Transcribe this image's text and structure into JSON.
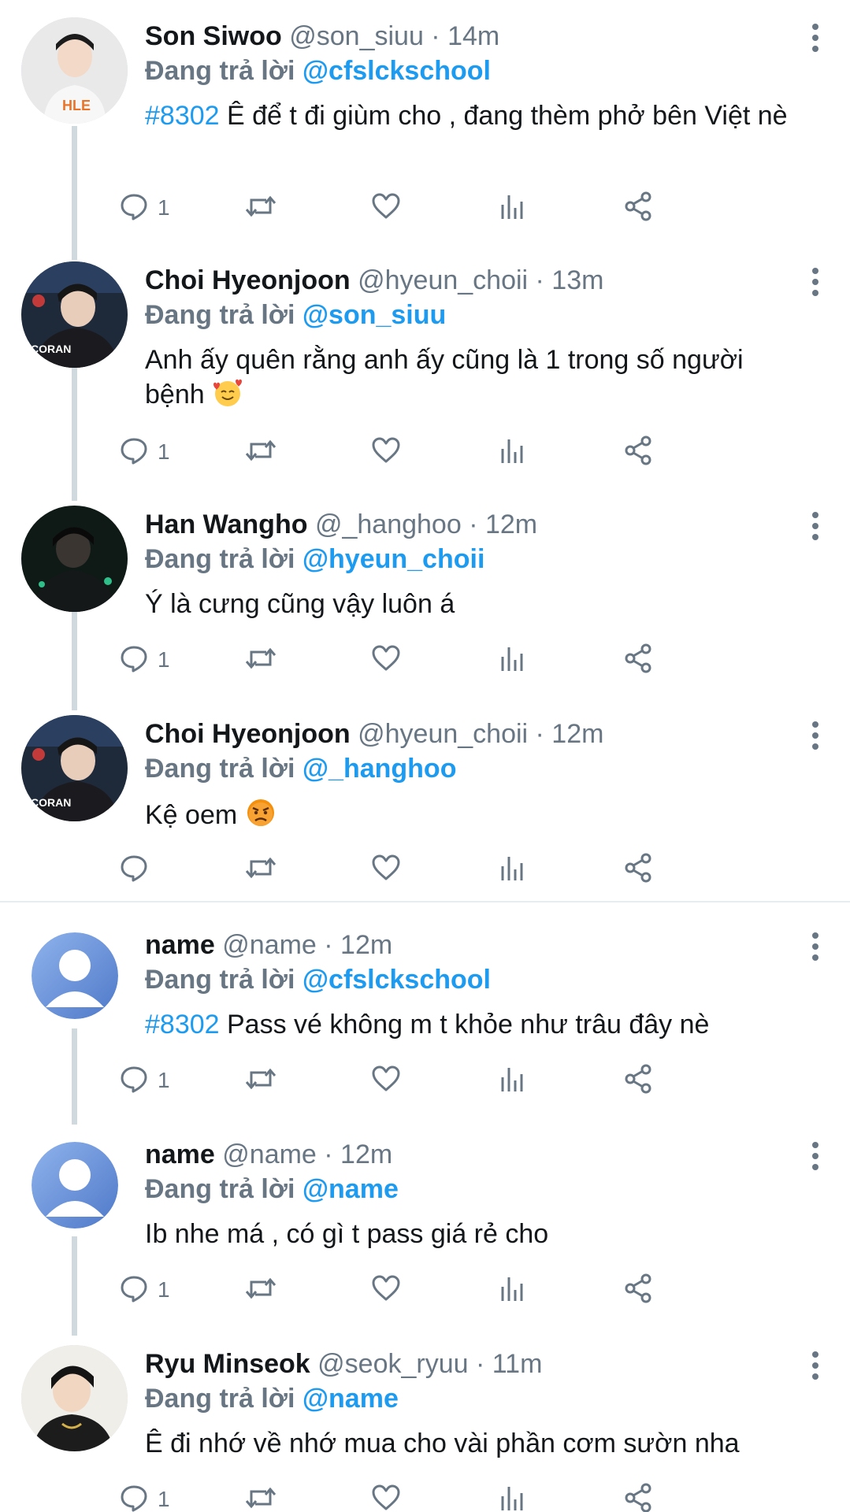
{
  "reply_prefix": "Đang trả lời",
  "tweets": [
    {
      "name": "Son Siwoo",
      "handle": "@son_siuu · 14m",
      "reply_to": "@cfslckschool",
      "hashtag": "#8302",
      "text": "Ê để t đi giùm cho , đang thèm phở bên Việt nè",
      "reply_count": "1",
      "avatar_color": "#e9e9ea"
    },
    {
      "name": "Choi Hyeonjoon",
      "handle": "@hyeun_choii · 13m",
      "reply_to": "@son_siuu",
      "hashtag": "",
      "text": "Anh ấy quên rằng anh ấy cũng là 1 trong số người bệnh",
      "reply_count": "1",
      "avatar_color": "#1e2a3a"
    },
    {
      "name": "Han Wangho",
      "handle": "@_hanghoo · 12m",
      "reply_to": "@hyeun_choii",
      "hashtag": "",
      "text": "Ý là cưng cũng vậy luôn á",
      "reply_count": "1",
      "avatar_color": "#0f1a17"
    },
    {
      "name": "Choi Hyeonjoon",
      "handle": "@hyeun_choii · 12m",
      "reply_to": "@_hanghoo",
      "hashtag": "",
      "text": "Kệ oem",
      "reply_count": "",
      "avatar_color": "#1e2a3a"
    },
    {
      "name": "name",
      "handle": "@name · 12m",
      "reply_to": "@cfslckschool",
      "hashtag": "#8302",
      "text": "Pass vé không m t khỏe như trâu đây nè",
      "reply_count": "1",
      "avatar_color": "#6f96d8"
    },
    {
      "name": "name",
      "handle": "@name · 12m",
      "reply_to": "@name",
      "hashtag": "",
      "text": "Ib nhe má , có gì t pass giá rẻ cho",
      "reply_count": "1",
      "avatar_color": "#6f96d8"
    },
    {
      "name": "Ryu Minseok",
      "handle": "@seok_ryuu · 11m",
      "reply_to": "@name",
      "hashtag": "",
      "text": "Ê đi nhớ về nhớ mua cho vài phần cơm sườn nha",
      "reply_count": "1",
      "avatar_color": "#2a2a2a"
    }
  ],
  "colors": {
    "link": "#1d9bf0",
    "muted": "#687684",
    "thread": "#cfd9de"
  }
}
